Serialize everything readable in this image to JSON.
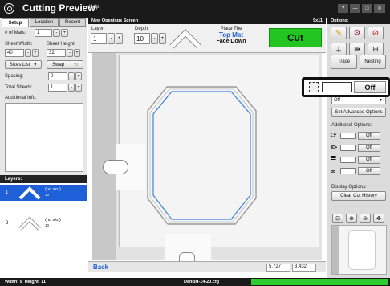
{
  "app": {
    "title": "Cutting Preview",
    "menu_help": "Help"
  },
  "window_controls": [
    "?",
    "—",
    "□",
    "✕"
  ],
  "left_panel": {
    "tabs": [
      "Setup",
      "Location",
      "Recent"
    ],
    "mats_label": "# of Mats:",
    "mats_value": "1",
    "sheet_width_label": "Sheet Width:",
    "sheet_width_value": "40",
    "sheet_height_label": "Sheet Height:",
    "sheet_height_value": "32",
    "sizes_list_label": "Sizes List",
    "swap_label": "Swap",
    "spacing_label": "Spacing:",
    "spacing_value": "0",
    "total_sheets_label": "Total Sheets:",
    "total_sheets_value": "1",
    "additional_info_label": "Additional Info:",
    "layers_label": "Layers:",
    "layers": [
      {
        "num": "1",
        "sku": "(no sku)",
        "qty": "10",
        "selected": true
      },
      {
        "num": "2",
        "sku": "(no sku)",
        "qty": "10",
        "selected": false
      }
    ],
    "stepper_minus": "-",
    "stepper_plus": "+"
  },
  "center": {
    "screen_title": "New Openings Screen",
    "screen_size": "9x11",
    "layer_label": "Layer:",
    "layer_value": "1",
    "depth_label": "Depth:",
    "depth_value": "10",
    "place_line1": "Place The",
    "place_line2": "Top Mat",
    "place_line3": "Face Down",
    "cut_label": "Cut",
    "back_label": "Back",
    "coord_x": "5.727",
    "coord_y": "3.432"
  },
  "right_panel": {
    "options_label": "Options:",
    "trace_label": "Trace",
    "nesting_label": "Nesting",
    "highlight_toggle_label": "Off",
    "dropdown_value": "Off",
    "advanced_options_label": "Set Advanced Options",
    "additional_options_label": "Additional Options:",
    "option_toggles": [
      "Off",
      "Off",
      "Off",
      "Off"
    ],
    "display_options_label": "Display Options:",
    "clear_history_label": "Clear Cut History"
  },
  "status_bar": {
    "dimensions": "Width: 9  Height: 11",
    "filename": "DanBH-14-20.cfg"
  },
  "colors": {
    "title_bar": "#1a1a1a",
    "cut_green": "#22c522",
    "layer_selected": "#1f5fd8",
    "mat_outline": "#3d7fe0",
    "status_green": "#2fcc2f"
  }
}
